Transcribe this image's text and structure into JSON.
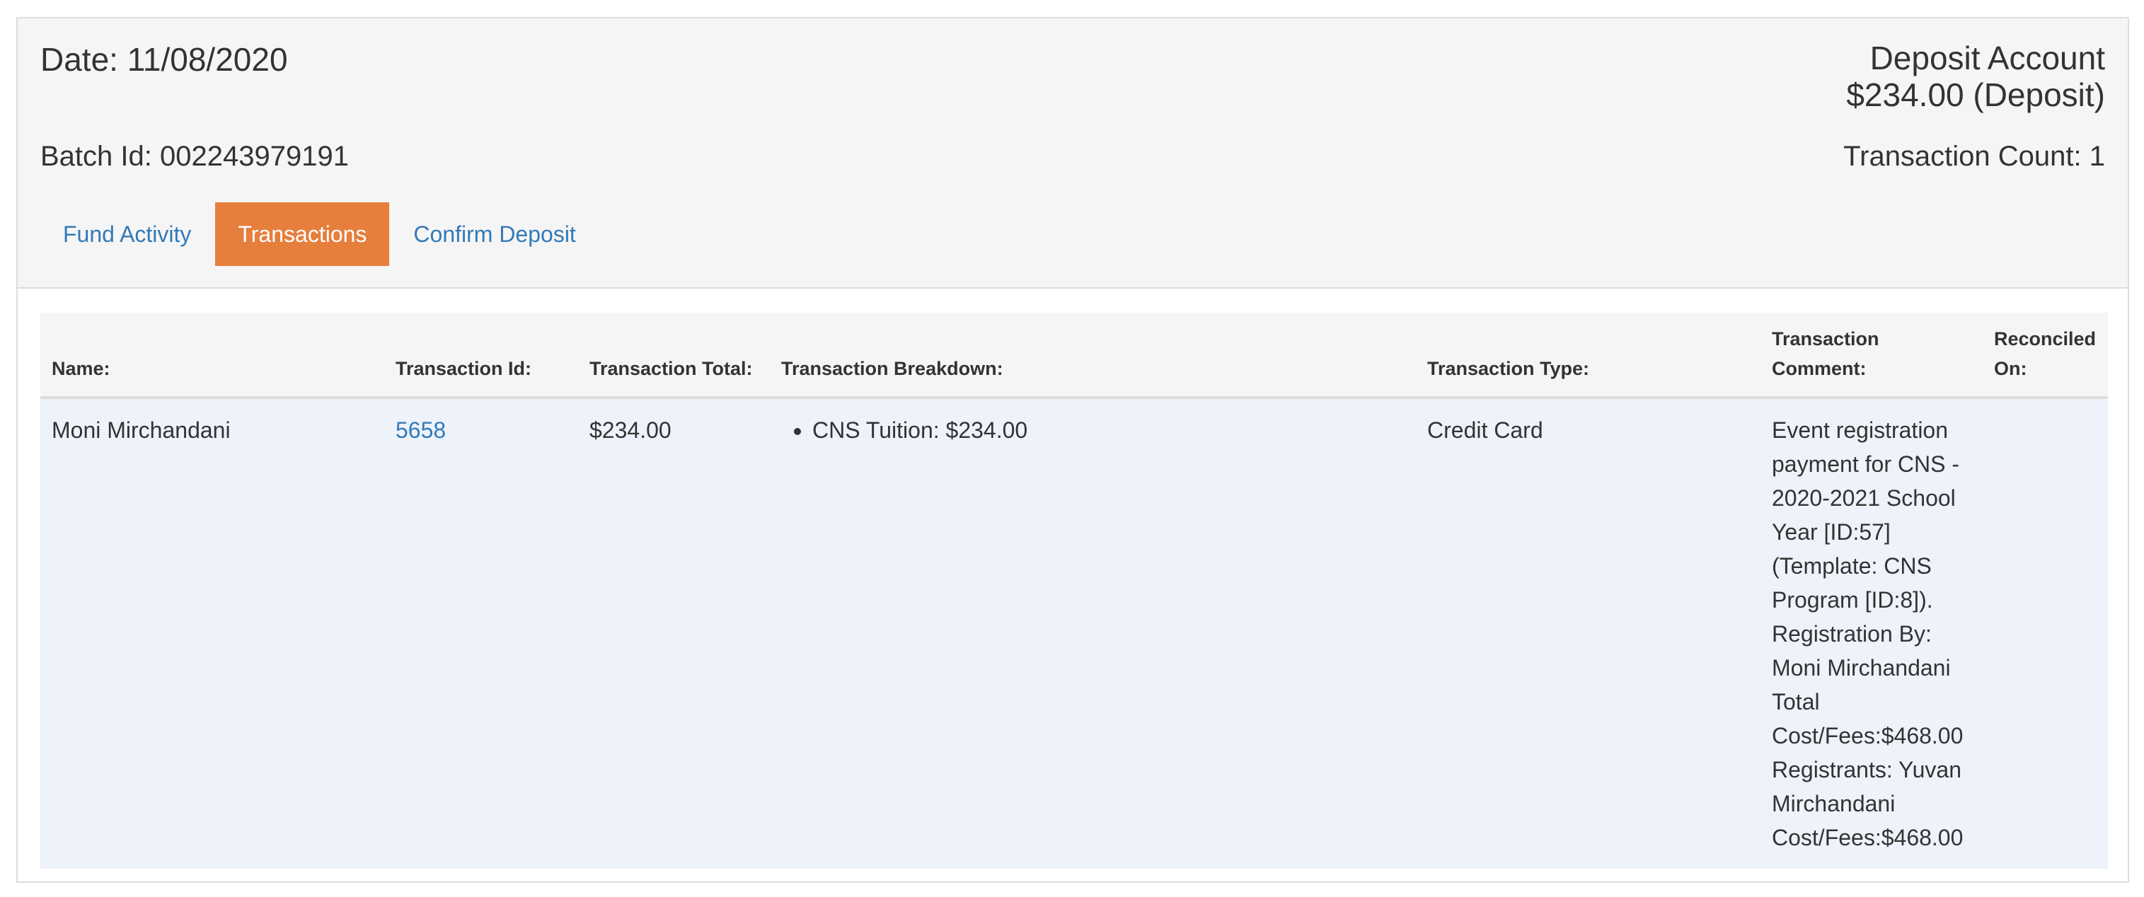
{
  "header": {
    "date": "Date: 11/08/2020",
    "account_name": "Deposit Account",
    "account_amount": "$234.00 (Deposit)",
    "batch_id": "Batch Id: 002243979191",
    "transaction_count": "Transaction Count: 1"
  },
  "tabs": [
    {
      "label": "Fund Activity",
      "active": false
    },
    {
      "label": "Transactions",
      "active": true
    },
    {
      "label": "Confirm Deposit",
      "active": false
    }
  ],
  "table": {
    "headers": {
      "name": "Name:",
      "transaction_id": "Transaction Id:",
      "transaction_total": "Transaction Total:",
      "breakdown": "Transaction Breakdown:",
      "type": "Transaction Type:",
      "comment": "Transaction Comment:",
      "reconciled": "Reconciled On:"
    },
    "rows": [
      {
        "name": "Moni Mirchandani",
        "transaction_id": "5658",
        "transaction_total": "$234.00",
        "breakdown": [
          "CNS Tuition: $234.00"
        ],
        "type": "Credit Card",
        "comment": "Event registration payment for CNS - 2020-2021 School Year [ID:57] (Template: CNS Program [ID:8]). Registration By: Moni Mirchandani Total Cost/Fees:$468.00 Registrants: Yuvan Mirchandani Cost/Fees:$468.00",
        "reconciled": ""
      }
    ]
  },
  "colors": {
    "accent": "#e67e3c",
    "link": "#337ab7",
    "row_background": "#edf2fb",
    "header_background": "#f5f5f5"
  }
}
